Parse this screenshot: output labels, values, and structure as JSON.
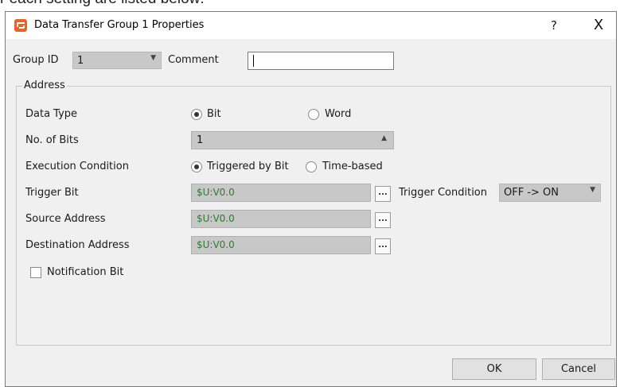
{
  "background_text": "r each setting are listed below:",
  "dialog": {
    "title": "Data Transfer Group 1 Properties",
    "help": "?",
    "close": "X"
  },
  "group_id": {
    "label": "Group ID",
    "value": "1"
  },
  "comment": {
    "label": "Comment",
    "value": ""
  },
  "address": {
    "title": "Address",
    "data_type": {
      "label": "Data Type",
      "options": [
        "Bit",
        "Word"
      ],
      "selected": "Bit"
    },
    "no_of_bits": {
      "label": "No. of Bits",
      "value": "1"
    },
    "execution_condition": {
      "label": "Execution Condition",
      "options": [
        "Triggered by Bit",
        "Time-based"
      ],
      "selected": "Triggered by Bit"
    },
    "trigger_bit": {
      "label": "Trigger Bit",
      "value": "$U:V0.0"
    },
    "trigger_condition": {
      "label": "Trigger Condition",
      "value": "OFF -> ON"
    },
    "source_address": {
      "label": "Source Address",
      "value": "$U:V0.0"
    },
    "destination_address": {
      "label": "Destination Address",
      "value": "$U:V0.0"
    },
    "notification_bit": {
      "label": "Notification Bit",
      "checked": false
    },
    "browse": "..."
  },
  "buttons": {
    "ok": "OK",
    "cancel": "Cancel"
  },
  "colors": {
    "icon": "#e8622a",
    "address_text": "#2c7a2c"
  },
  "icons": {
    "app": "app-icon",
    "dropdown": "chevron-down-icon",
    "spinner": "chevron-up-icon"
  }
}
